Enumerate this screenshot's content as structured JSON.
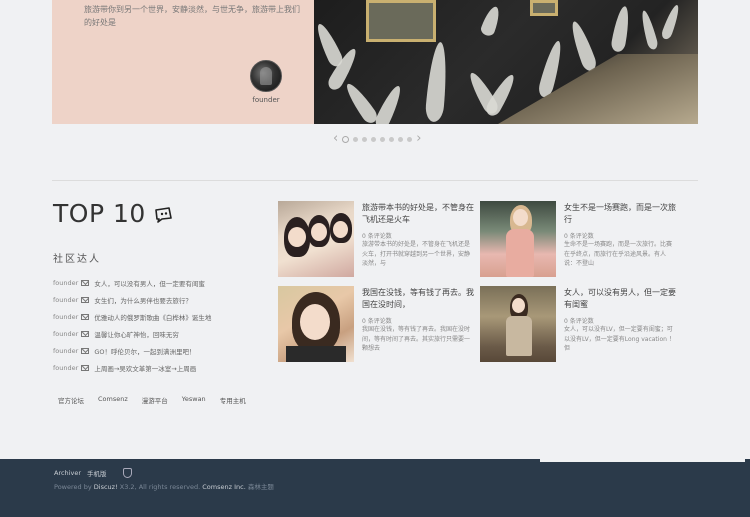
{
  "hero": {
    "text": "旅游带你到另一个世界，安静淡然，与世无争，旅游带上我们的好处是",
    "author": "founder"
  },
  "slider": {
    "prev_icon": "chevron-left-icon",
    "next_icon": "chevron-right-icon",
    "dot_count": 8,
    "active_index": 0
  },
  "top10": {
    "title": "TOP 10",
    "icon": "chat-bubble-icon"
  },
  "talent": {
    "title": "社区达人",
    "items": [
      {
        "user": "founder",
        "text": "女人，可以没有男人，但一定要有闺蜜"
      },
      {
        "user": "founder",
        "text": "女生们，为什么男伴也要去旅行？"
      },
      {
        "user": "founder",
        "text": "优雅动人的俄罗斯歌曲《白桦林》诞生地"
      },
      {
        "user": "founder",
        "text": "温馨让你心旷神怡，回味无穷"
      },
      {
        "user": "founder",
        "text": "GO！呼伦贝尔，一起到满洲里吧！"
      },
      {
        "user": "founder",
        "text": "上周画→吴欢文革第一冰室→上周画"
      }
    ]
  },
  "footer_links": [
    "官方论坛",
    "Comsenz",
    "漫游平台",
    "Yeswan",
    "专用主机"
  ],
  "articles": [
    {
      "title": "旅游带本书的好处是，不管身在飞机还是火车",
      "comments": "0 条评论数",
      "excerpt": "旅游带本书的好处是，不管身在飞机还是火车，打开书就穿越到另一个世界，安静淡然，与"
    },
    {
      "title": "女生不是一场赛跑，而是一次旅行",
      "comments": "0 条评论数",
      "excerpt": "生命不是一场赛跑，而是一次旅行。比赛在乎终点，而旅行在乎沿途风景。有人说：不登山"
    },
    {
      "title": "我国在没钱，等有钱了再去。我国在没时间，",
      "comments": "0 条评论数",
      "excerpt": "我国在没钱，等有钱了再去。我国在没时间，等有时间了再去。其实旅行只需要一颗想去"
    },
    {
      "title": "女人，可以没有男人，但一定要有闺蜜",
      "comments": "0 条评论数",
      "excerpt": "女人，可以没有LV，但一定要有闺蜜；可以没有LV，但一定要有Long vacation ！ 但"
    }
  ],
  "page_footer": {
    "archiver": "Archiver",
    "mobile": "手机版",
    "shield_icon": "shield-icon",
    "powered_by": "Powered by",
    "product": "Discuz!",
    "version": "X3.2",
    "rights": ", All rights reserved.",
    "company": "Comsenz Inc.",
    "theme": "森林主题"
  }
}
